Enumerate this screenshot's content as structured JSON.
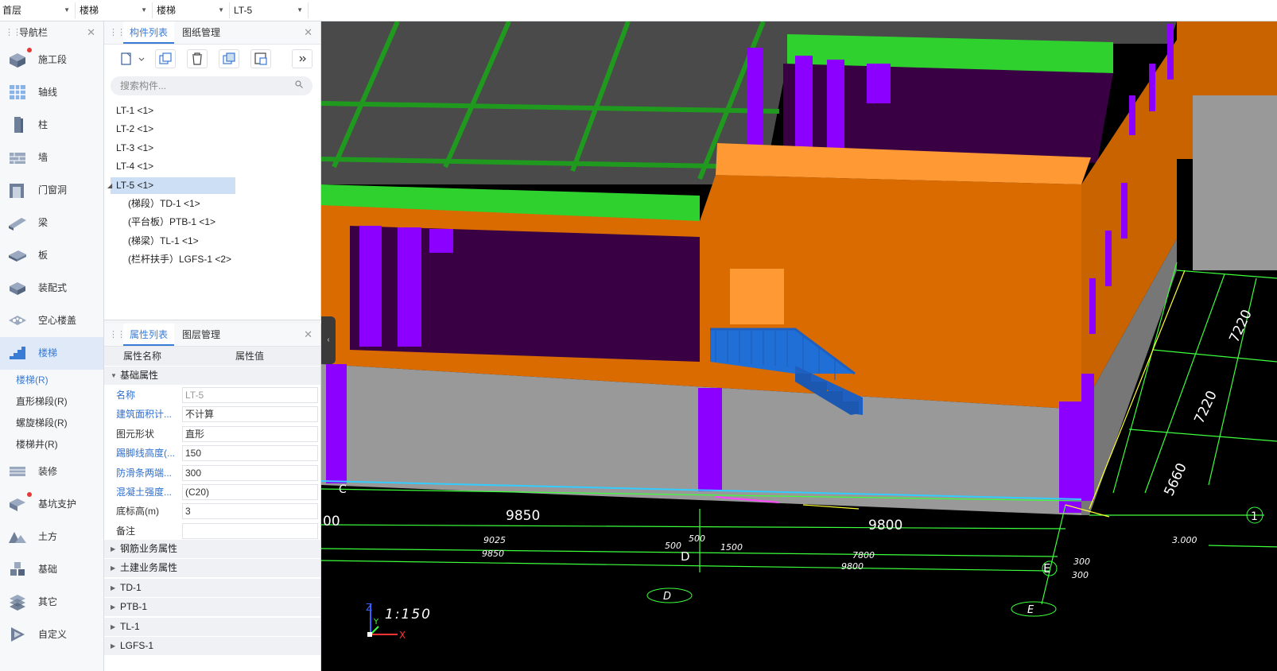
{
  "top_selectors": [
    {
      "value": "首层"
    },
    {
      "value": "楼梯"
    },
    {
      "value": "楼梯"
    },
    {
      "value": "LT-5"
    }
  ],
  "nav": {
    "title": "导航栏",
    "items": [
      {
        "label": "施工段",
        "icon": "construction-section-icon",
        "dot": true
      },
      {
        "label": "轴线",
        "icon": "axis-grid-icon"
      },
      {
        "label": "柱",
        "icon": "column-icon"
      },
      {
        "label": "墙",
        "icon": "wall-icon"
      },
      {
        "label": "门窗洞",
        "icon": "door-window-icon"
      },
      {
        "label": "梁",
        "icon": "beam-icon"
      },
      {
        "label": "板",
        "icon": "slab-icon"
      },
      {
        "label": "装配式",
        "icon": "prefab-icon"
      },
      {
        "label": "空心楼盖",
        "icon": "hollow-floor-icon"
      },
      {
        "label": "楼梯",
        "icon": "stair-icon",
        "active": true
      }
    ],
    "sub_items": [
      {
        "label": "楼梯(R)",
        "active": true
      },
      {
        "label": "直形梯段(R)"
      },
      {
        "label": "螺旋梯段(R)"
      },
      {
        "label": "楼梯井(R)"
      }
    ],
    "items2": [
      {
        "label": "装修",
        "icon": "decoration-icon"
      },
      {
        "label": "基坑支护",
        "icon": "pit-support-icon",
        "dot": true
      },
      {
        "label": "土方",
        "icon": "earthwork-icon"
      },
      {
        "label": "基础",
        "icon": "foundation-icon"
      },
      {
        "label": "其它",
        "icon": "other-icon"
      },
      {
        "label": "自定义",
        "icon": "custom-icon"
      }
    ]
  },
  "component_panel": {
    "tabs": [
      "构件列表",
      "图纸管理"
    ],
    "search_placeholder": "搜索构件...",
    "toolbar_icons": [
      "new-icon",
      "copy-icon",
      "delete-icon",
      "layer-copy-icon",
      "floor-copy-icon",
      "more-icon"
    ],
    "tree": [
      {
        "label": "LT-1 <1>",
        "level": 0
      },
      {
        "label": "LT-2 <1>",
        "level": 0
      },
      {
        "label": "LT-3 <1>",
        "level": 0
      },
      {
        "label": "LT-4 <1>",
        "level": 0
      },
      {
        "label": "LT-5 <1>",
        "level": 0,
        "selected": true,
        "expanded": true
      },
      {
        "label": "(梯段）TD-1 <1>",
        "level": 1
      },
      {
        "label": "(平台板）PTB-1 <1>",
        "level": 1
      },
      {
        "label": "(梯梁）TL-1 <1>",
        "level": 1
      },
      {
        "label": "(栏杆扶手）LGFS-1 <2>",
        "level": 1
      }
    ]
  },
  "property_panel": {
    "tabs": [
      "属性列表",
      "图层管理"
    ],
    "col_name": "属性名称",
    "col_value": "属性值",
    "section": "基础属性",
    "rows": [
      {
        "key": "名称",
        "value": "LT-5",
        "blue": true,
        "dim": true
      },
      {
        "key": "建筑面积计...",
        "value": "不计算",
        "blue": true
      },
      {
        "key": "图元形状",
        "value": "直形",
        "blue": false
      },
      {
        "key": "踢脚线高度(...",
        "value": "150",
        "blue": true
      },
      {
        "key": "防滑条两端...",
        "value": "300",
        "blue": true
      },
      {
        "key": "混凝土强度...",
        "value": "(C20)",
        "blue": true
      },
      {
        "key": "底标高(m)",
        "value": "3",
        "blue": false
      },
      {
        "key": "备注",
        "value": "",
        "blue": false
      }
    ],
    "groups": [
      "钢筋业务属性",
      "土建业务属性",
      "TD-1",
      "PTB-1",
      "TL-1",
      "LGFS-1"
    ]
  },
  "viewport": {
    "scale_text": "1:150",
    "dims": [
      "9850",
      "9800",
      "9025",
      "9850",
      "500",
      "500",
      "1500",
      "7800",
      "9800",
      "300",
      "300",
      "3.000",
      "7220",
      "7220",
      "5660"
    ],
    "axis_labels": [
      "C",
      "D",
      "E",
      "D",
      "E",
      "1",
      "00"
    ],
    "axis_letters": {
      "x": "X",
      "y": "Y",
      "z": "Z"
    }
  },
  "colors": {
    "accent": "#3a7bd5",
    "wall_orange": "#d96b00",
    "column_purple": "#8b00ff",
    "beam_green": "#2fd12f",
    "stair_blue": "#1f6fd6",
    "cad_green": "#3cff3c"
  }
}
